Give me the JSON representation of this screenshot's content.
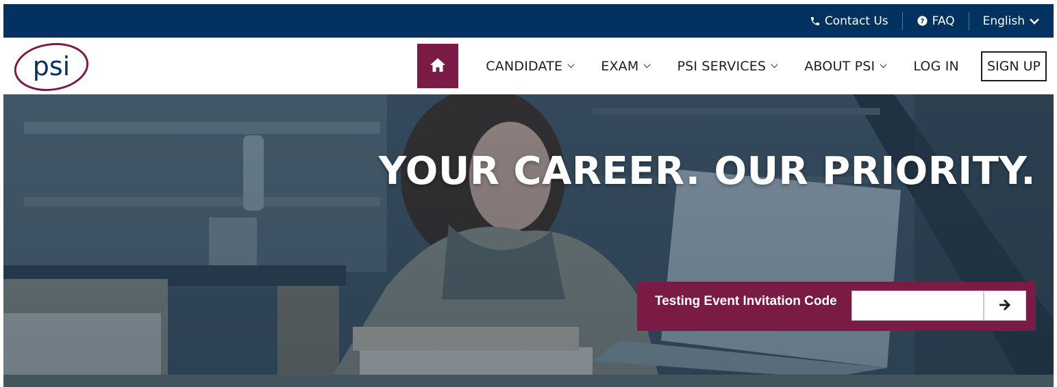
{
  "topbar": {
    "contact_label": "Contact Us",
    "faq_label": "FAQ",
    "language_label": "English",
    "icons": {
      "contact": "phone-icon",
      "faq": "question-circle-icon",
      "language": "chevron-down-icon"
    }
  },
  "navbar": {
    "logo_text": "psi",
    "items": [
      {
        "label": "CANDIDATE",
        "has_dropdown": true
      },
      {
        "label": "EXAM",
        "has_dropdown": true
      },
      {
        "label": "PSI SERVICES",
        "has_dropdown": true
      },
      {
        "label": "ABOUT PSI",
        "has_dropdown": true
      },
      {
        "label": "LOG IN",
        "has_dropdown": false
      }
    ],
    "signup_label": "SIGN UP",
    "home_icon": "home-icon"
  },
  "hero": {
    "headline": "YOUR CAREER. OUR PRIORITY.",
    "invite": {
      "label": "Testing Event Invitation Code",
      "value": "",
      "placeholder": "",
      "submit_icon": "arrow-right-icon"
    }
  },
  "colors": {
    "topbar_bg": "#033260",
    "brand": "#7a1b45",
    "text_dark": "#1d1d1d",
    "white": "#ffffff"
  }
}
